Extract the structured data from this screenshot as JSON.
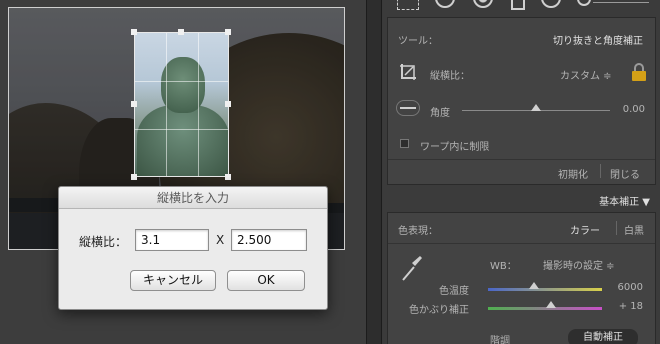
{
  "dialog": {
    "title": "縦横比を入力",
    "ratio_label": "縦横比：",
    "width_value": "3.1",
    "times": "X",
    "height_value": "2.500",
    "cancel_label": "キャンセル",
    "ok_label": "OK"
  },
  "crop_panel": {
    "tool_label": "ツール：",
    "tool_name": "切り抜きと角度補正",
    "aspect_label": "縦横比：",
    "aspect_value": "カスタム ≑",
    "angle_label": "角度",
    "angle_value": "0.00",
    "constrain_label": "ワープ内に制限",
    "reset_label": "初期化",
    "close_label": "閉じる"
  },
  "basic_panel": {
    "title": "基本補正 ▼",
    "treatment_label": "色表現：",
    "color_option": "カラー",
    "bw_option": "白黒",
    "wb_label": "WB：",
    "wb_value": "撮影時の設定 ≑",
    "temp_label": "色温度",
    "temp_value": "6000",
    "tint_label": "色かぶり補正",
    "tint_value": "+ 18",
    "tone_label": "階調",
    "auto_label": "自動補正"
  },
  "sliders": {
    "angle_pos": 0.5,
    "temp_pos": 0.4,
    "tint_pos": 0.55
  },
  "colors": {
    "accent_lock": "#d4a017",
    "temp_left": "#4a66c8",
    "temp_right": "#d8d04a",
    "tint_left": "#4fb04f",
    "tint_right": "#c84fc8"
  }
}
